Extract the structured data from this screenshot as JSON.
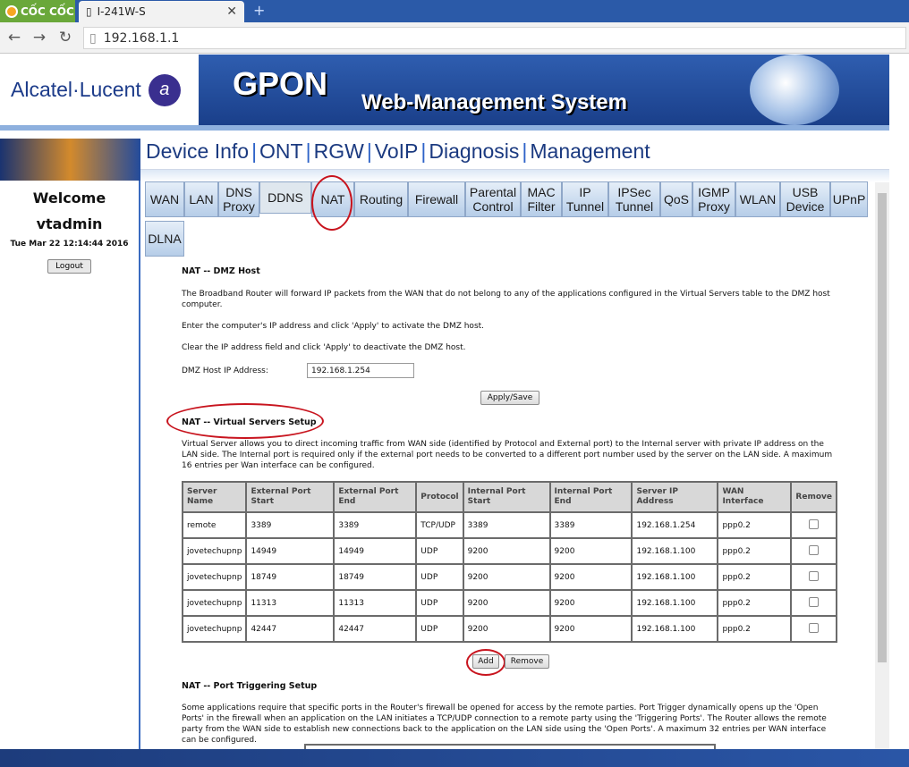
{
  "browser": {
    "brand": "CỐC CỐC",
    "tab_title": "I-241W-S",
    "tab_close": "✕",
    "new_tab": "+",
    "url": "192.168.1.1"
  },
  "banner": {
    "logo_text": "Alcatel·Lucent",
    "title": "GPON",
    "subtitle": "Web-Management System"
  },
  "sidebar": {
    "welcome": "Welcome",
    "user": "vtadmin",
    "datetime": "Tue Mar 22 12:14:44 2016",
    "logout": "Logout"
  },
  "topmenu": [
    "Device Info",
    "ONT",
    "RGW",
    "VoIP",
    "Diagnosis",
    "Management"
  ],
  "subtabs": [
    "WAN",
    "LAN",
    "DNS Proxy",
    "DDNS",
    "NAT",
    "Routing",
    "Firewall",
    "Parental Control",
    "MAC Filter",
    "IP Tunnel",
    "IPSec Tunnel",
    "QoS",
    "IGMP Proxy",
    "WLAN",
    "USB Device",
    "UPnP",
    "DLNA"
  ],
  "dmz": {
    "heading": "NAT -- DMZ Host",
    "desc1": "The Broadband Router will forward IP packets from the WAN that do not belong to any of the applications configured in the Virtual Servers table to the DMZ host computer.",
    "desc2": "Enter the computer's IP address and click 'Apply' to activate the DMZ host.",
    "desc3": "Clear the IP address field and click 'Apply' to deactivate the DMZ host.",
    "field_label": "DMZ Host IP Address:",
    "field_value": "192.168.1.254",
    "apply": "Apply/Save"
  },
  "vs": {
    "heading": "NAT -- Virtual Servers Setup",
    "desc": "Virtual Server allows you to direct incoming traffic from WAN side (identified by Protocol and External port) to the Internal server with private IP address on the LAN side. The Internal port is required only if the external port needs to be converted to a different port number used by the server on the LAN side. A maximum 16 entries per Wan interface can be configured.",
    "columns": [
      "Server Name",
      "External Port Start",
      "External Port End",
      "Protocol",
      "Internal Port Start",
      "Internal Port End",
      "Server IP Address",
      "WAN Interface",
      "Remove"
    ],
    "rows": [
      [
        "remote",
        "3389",
        "3389",
        "TCP/UDP",
        "3389",
        "3389",
        "192.168.1.254",
        "ppp0.2"
      ],
      [
        "jovetechupnp",
        "14949",
        "14949",
        "UDP",
        "9200",
        "9200",
        "192.168.1.100",
        "ppp0.2"
      ],
      [
        "jovetechupnp",
        "18749",
        "18749",
        "UDP",
        "9200",
        "9200",
        "192.168.1.100",
        "ppp0.2"
      ],
      [
        "jovetechupnp",
        "11313",
        "11313",
        "UDP",
        "9200",
        "9200",
        "192.168.1.100",
        "ppp0.2"
      ],
      [
        "jovetechupnp",
        "42447",
        "42447",
        "UDP",
        "9200",
        "9200",
        "192.168.1.100",
        "ppp0.2"
      ]
    ],
    "add": "Add",
    "remove": "Remove"
  },
  "pt": {
    "heading": "NAT -- Port Triggering Setup",
    "desc": "Some applications require that specific ports in the Router's firewall be opened for access by the remote parties. Port Trigger dynamically opens up the 'Open Ports' in the firewall when an application on the LAN initiates a TCP/UDP connection to a remote party using the 'Triggering Ports'. The Router allows the remote party from the WAN side to establish new connections back to the application on the LAN side using the 'Open Ports'. A maximum 32 entries per WAN interface can be configured."
  },
  "colors": {
    "accent": "#1b3a80",
    "annotation": "#c8141e",
    "tab_bg": "#b6cde8"
  }
}
